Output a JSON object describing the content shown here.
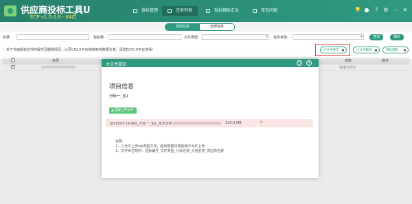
{
  "header": {
    "app_title": "供应商投标工具U",
    "version": "ECP v1.0.0.8 - 64位",
    "nav": [
      {
        "label": "投标管理"
      },
      {
        "label": "任务列表"
      },
      {
        "label": "投标辅助汇总"
      },
      {
        "label": "常见问题"
      }
    ],
    "icons": [
      "bulb-icon",
      "user-icon",
      "help-icon",
      "gear-icon",
      "minimize-icon",
      "close-icon"
    ]
  },
  "subtabs": [
    {
      "label": "当前任务",
      "active": true
    },
    {
      "label": "全部任务",
      "active": false
    }
  ],
  "filters": {
    "dir_label": "目录:",
    "pkg_label": "包名称:",
    "filetype_label": "文件类型:",
    "status_label": "任务状态:",
    "search_button": "查询",
    "confirm_button": "确定"
  },
  "notice": "关于全面投标文件的提交及删除情况，以至CP2.0平台接收到的数据为准。请登ECP2.0平台查看!",
  "side_buttons": [
    "大文件提交",
    "大文件删除",
    "待处理数"
  ],
  "table": {
    "headers": [
      "目录",
      "进度",
      "操作"
    ],
    "rows": [
      {
        "progress": "进度100%"
      }
    ]
  },
  "modal": {
    "title": "大文件提交",
    "section_title": "项目信息",
    "project_name": "分标一_包1",
    "upload_button": "选择上传文件",
    "file_name": "SD-TEXT-26-065_分标一_包1_技术文件",
    "file_size": "229.9 MB",
    "notes_title": "说明",
    "notes": [
      "1、只允许上传zip类型文件，超出限额将被拒绝不允许上传",
      "2、文件命名规则：招标编号_文件类型_分标名称_分包名称_供应商名称"
    ]
  },
  "colors": {
    "primary": "#2f9a80",
    "header": "#27806b",
    "accent_red": "#e23b2e",
    "version_yellow": "#ffe45a"
  }
}
